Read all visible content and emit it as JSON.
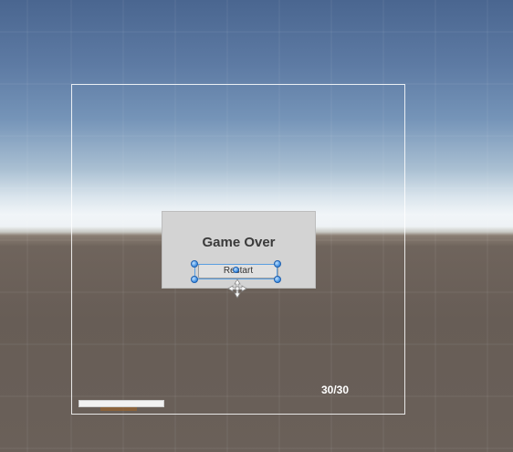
{
  "game_over_panel": {
    "title": "Game Over",
    "restart_label": "Restart"
  },
  "hud": {
    "counter": "30/30",
    "health_fraction": 1.0
  },
  "colors": {
    "sky_top": "#4a6690",
    "horizon": "#f1f5f8",
    "ground": "#675d56",
    "panel_bg": "#d3d3d3",
    "selection": "#5a9ee0"
  },
  "icons": [
    "move-pivot-icon",
    "selection-handle-icon"
  ]
}
